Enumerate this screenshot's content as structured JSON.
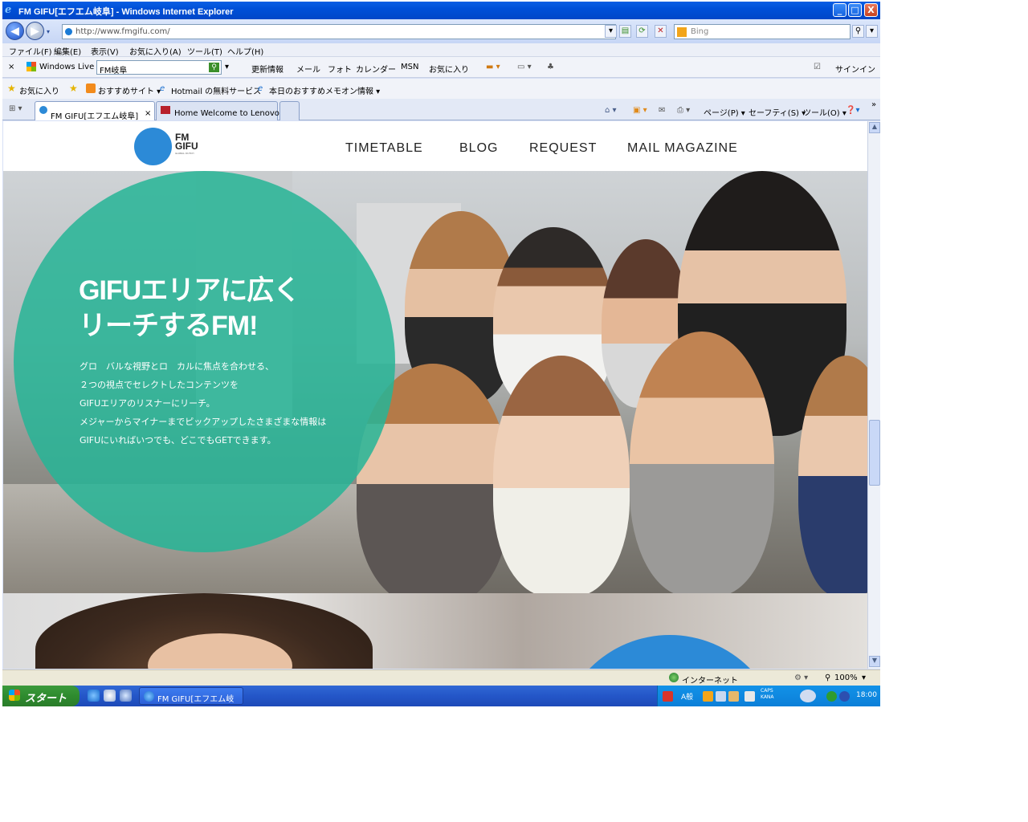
{
  "window": {
    "title": "FM GIFU[エフエム岐阜] - Windows Internet Explorer",
    "min": "_",
    "max": "□",
    "close": "X"
  },
  "address_bar": {
    "url": "http://www.fmgifu.com/",
    "search_placeholder": "Bing"
  },
  "menu": [
    "ファイル(F)",
    "編集(E)",
    "表示(V)",
    "お気に入り(A)",
    "ツール(T)",
    "ヘルプ(H)"
  ],
  "live_toolbar": {
    "close": "×",
    "brand": "Windows Live",
    "search_value": "FM岐阜",
    "links": [
      "更新情報",
      "メール",
      "フォト",
      "カレンダー",
      "MSN",
      "お気に入り"
    ],
    "signin": "サインイン"
  },
  "favorites": {
    "label": "お気に入り",
    "items": [
      "おすすめサイト ▾",
      "Hotmail の無料サービス",
      "本日のおすすめメモオン情報 ▾"
    ]
  },
  "tabs": [
    {
      "label": "FM GIFU[エフエム岐阜]",
      "close": "×"
    },
    {
      "label": "Home Welcome to Lenovo"
    }
  ],
  "command_bar": {
    "page": "ページ(P) ▾",
    "safety": "セーフティ(S) ▾",
    "tools": "ツール(O) ▾",
    "more": "»"
  },
  "site": {
    "logo_line1": "FM",
    "logo_line2": "GIFU",
    "logo_sub": "GLOBAL DUTCH",
    "nav": [
      "TIMETABLE",
      "BLOG",
      "REQUEST",
      "MAIL MAGAZINE"
    ],
    "hero_title_line1": "GIFUエリアに広く",
    "hero_title_line2": "リーチするFM!",
    "hero_copy": [
      "グロ　バルな視野とロ　カルに焦点を合わせる、",
      "２つの視点でセレクトしたコンテンツを",
      "GIFUエリアのリスナーにリーチ。",
      "メジャーからマイナーまでピックアップしたさまざまな情報は",
      "GIFUにいればいつでも、どこでもGETできます。"
    ]
  },
  "status_bar": {
    "zone": "インターネット",
    "zoom": "100%"
  },
  "taskbar": {
    "start": "スタート",
    "task": "FM GIFU[エフエム岐",
    "ime": "A般",
    "caps": "CAPS",
    "kana": "KANA",
    "clock": "18:00"
  },
  "colors": {
    "teal_circle": "#27b496",
    "logo_blue": "#2c8ad7",
    "xp_blue": "#0050d8",
    "start_green": "#2e8b2e"
  }
}
